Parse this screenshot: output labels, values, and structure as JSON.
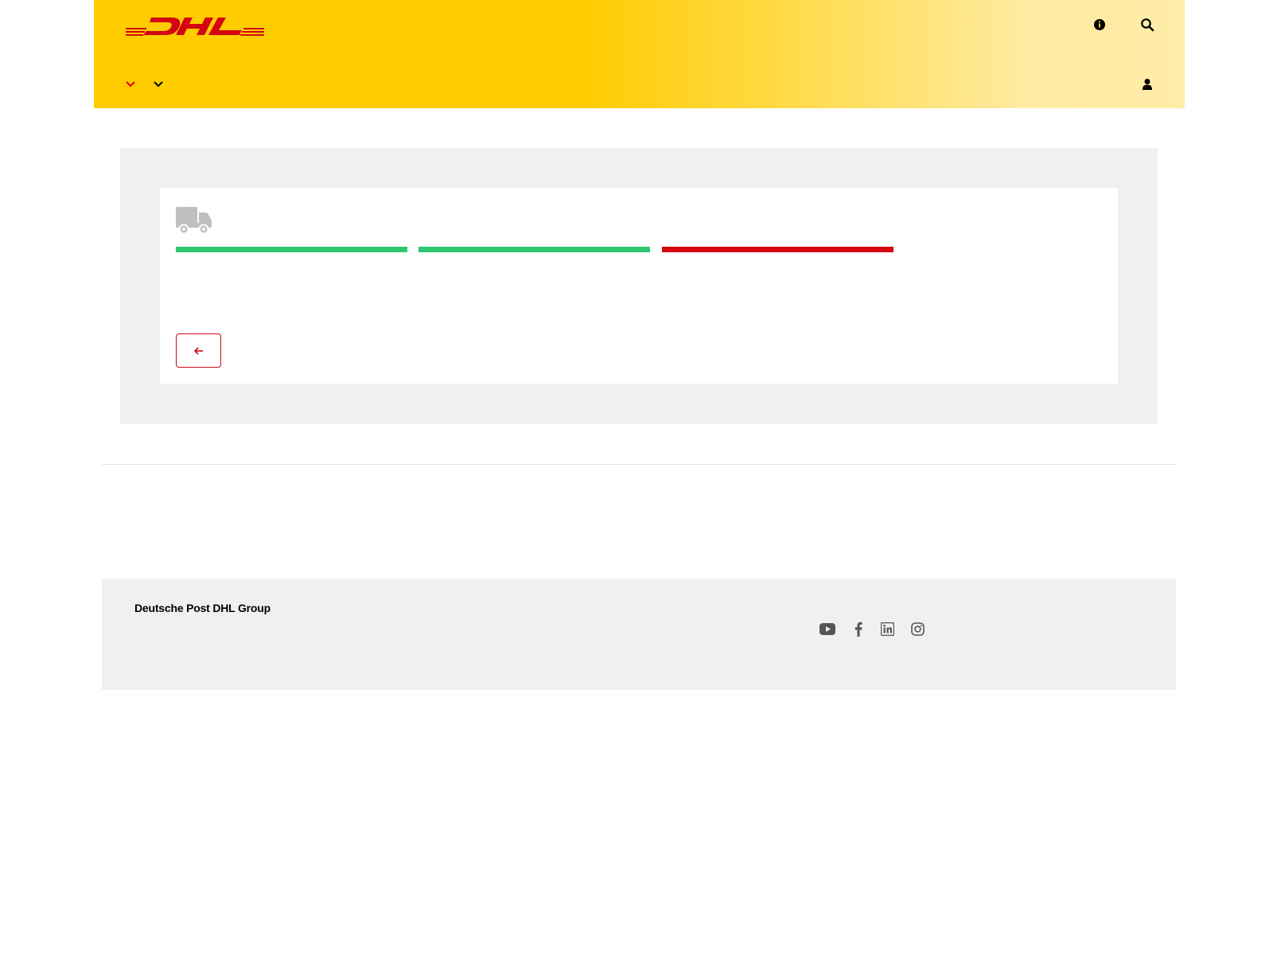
{
  "header": {
    "logo_text": "DHL",
    "icons": {
      "info": "info-icon",
      "search": "search-icon",
      "user": "user-icon",
      "nav_chevrons": [
        "chevron-down-icon",
        "chevron-down-icon"
      ]
    }
  },
  "main": {
    "icon": "truck-icon",
    "progress_steps": [
      {
        "status": "complete",
        "color": "#2ec76f"
      },
      {
        "status": "complete",
        "color": "#2ec76f"
      },
      {
        "status": "current",
        "color": "#d40511"
      }
    ],
    "back_button_icon": "arrow-left-icon"
  },
  "footer": {
    "brand": "Deutsche Post DHL Group",
    "social_icons": [
      "youtube-icon",
      "facebook-icon",
      "linkedin-icon",
      "instagram-icon"
    ]
  },
  "colors": {
    "brand_yellow": "#ffcc00",
    "brand_red": "#d40511",
    "progress_green": "#2ec76f",
    "panel_gray": "#f0f0f0"
  }
}
